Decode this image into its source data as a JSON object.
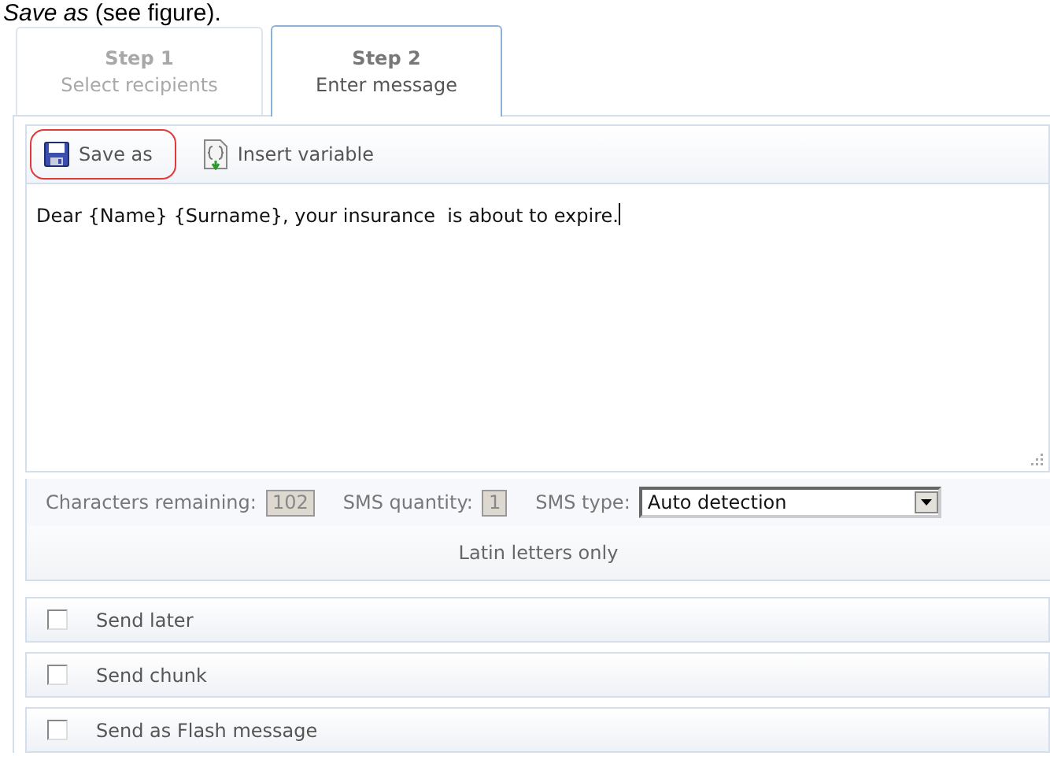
{
  "caption": "*Save as* (see figure).",
  "tabs": [
    {
      "step": "Step 1",
      "label": "Select recipients",
      "selected": false,
      "disabled": true
    },
    {
      "step": "Step 2",
      "label": "Enter message",
      "selected": true,
      "disabled": false
    }
  ],
  "toolbar": [
    {
      "label": "Save as",
      "kind": "floppy",
      "highlighted": true
    },
    {
      "label": "Insert variable",
      "kind": "variable",
      "highlighted": false
    }
  ],
  "message": "Dear {Name} {Surname}, your insurance  is about to expire.",
  "counters": {
    "characters_remaining_label": "Characters remaining:",
    "characters_remaining": "102",
    "sms_quantity_label": "SMS quantity:",
    "sms_quantity": "1",
    "sms_type_label": "SMS type:",
    "sms_type": "Auto detection"
  },
  "encoding_note": "Latin letters only",
  "options": [
    {
      "label": "Send later",
      "checked": false
    },
    {
      "label": "Send chunk",
      "checked": false
    },
    {
      "label": "Send as Flash message",
      "checked": false
    }
  ]
}
